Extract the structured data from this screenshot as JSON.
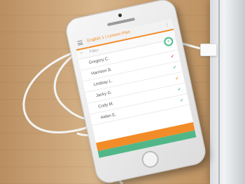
{
  "app": {
    "header_title": "English 1 | Lesson Plan",
    "filter_label": "Filter",
    "fab_label": "+"
  },
  "students": [
    {
      "name": "Gregory C.",
      "mark": ""
    },
    {
      "name": "Harrison B.",
      "mark": "✔"
    },
    {
      "name": "Lindsay L.",
      "mark": "✔"
    },
    {
      "name": "Jacky G.",
      "mark": "✔"
    },
    {
      "name": "Cody M.",
      "mark": "✔"
    },
    {
      "name": "Aidan E.",
      "mark": "✔"
    }
  ],
  "bottom_bar_label": "",
  "colors": {
    "accent": "#f28c28",
    "green": "#52b788",
    "wood": "#c9a77e",
    "cable": "#f4f4f4"
  }
}
